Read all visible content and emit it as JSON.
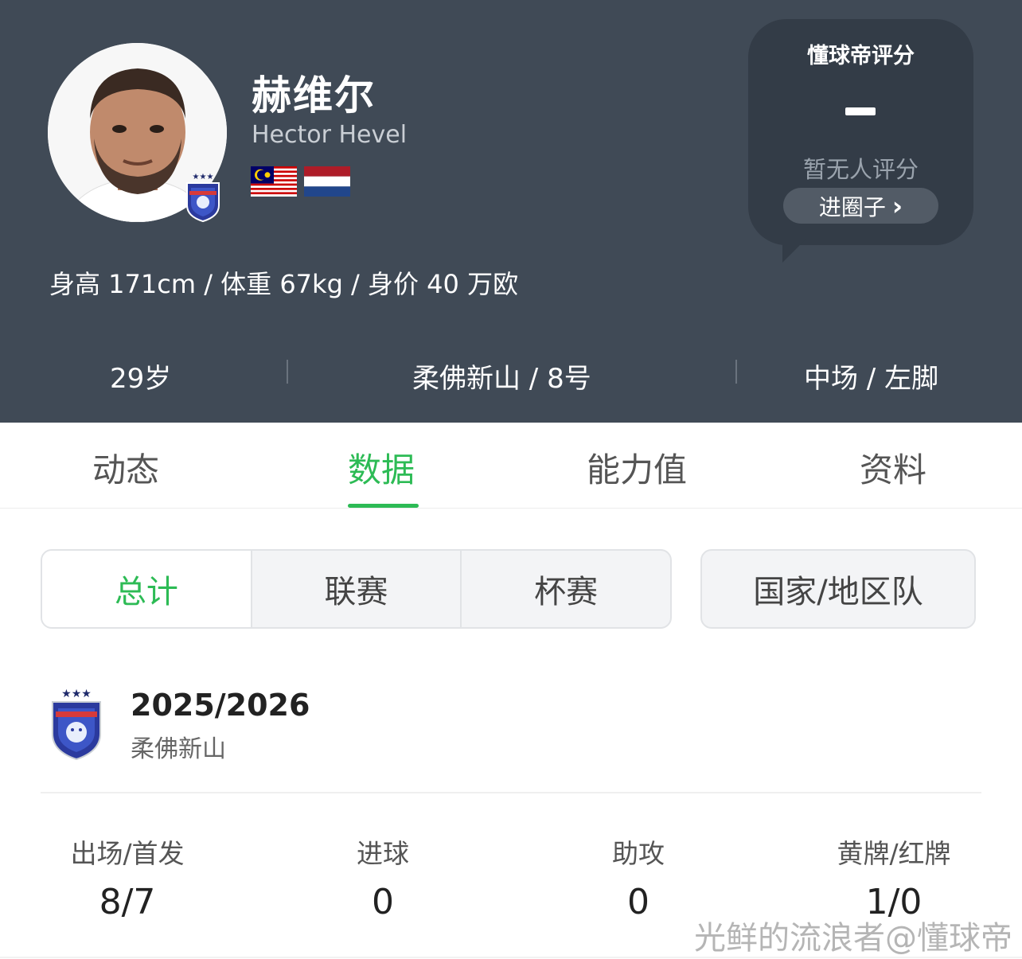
{
  "player": {
    "name_cn": "赫维尔",
    "name_en": "Hector Hevel",
    "body_stats": "身高 171cm / 体重 67kg / 身价 40 万欧",
    "age": "29岁",
    "club_number": "柔佛新山 / 8号",
    "position_foot": "中场 / 左脚",
    "flags": [
      "malaysia-flag",
      "netherlands-flag"
    ]
  },
  "rating": {
    "title": "懂球帝评分",
    "empty_text": "暂无人评分",
    "join_label": "进圈子",
    "join_chevron": "›"
  },
  "tabs": [
    "动态",
    "数据",
    "能力值",
    "资料"
  ],
  "active_tab": 1,
  "segments": [
    "总计",
    "联赛",
    "杯赛"
  ],
  "national_label": "国家/地区队",
  "season": {
    "year": "2025/2026",
    "club": "柔佛新山"
  },
  "stats": [
    {
      "label": "出场/首发",
      "value": "8/7"
    },
    {
      "label": "进球",
      "value": "0"
    },
    {
      "label": "助攻",
      "value": "0"
    },
    {
      "label": "黄牌/红牌",
      "value": "1/0"
    }
  ],
  "watermark": "光鲜的流浪者@懂球帝",
  "colors": {
    "header_bg": "#404a56",
    "accent_green": "#2dbb55",
    "rating_bg": "#333c47"
  }
}
